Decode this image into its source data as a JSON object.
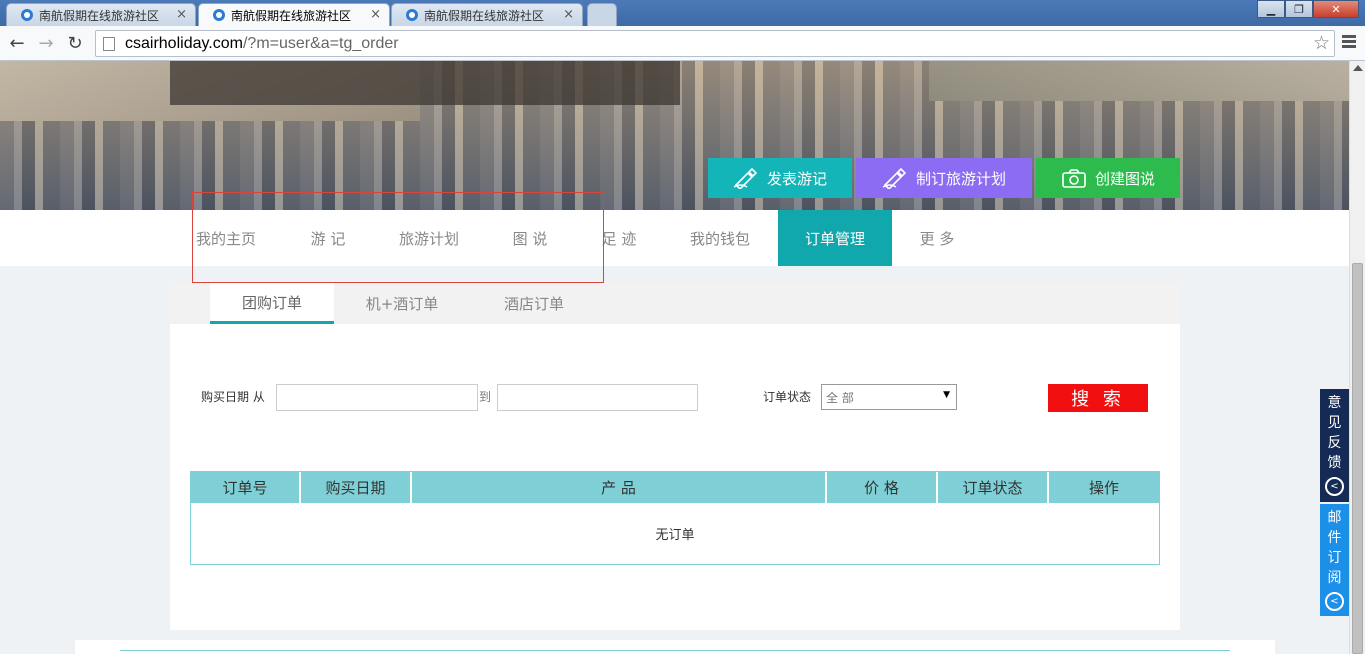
{
  "browser": {
    "tabs": [
      {
        "title": "南航假期在线旅游社区",
        "active": false
      },
      {
        "title": "南航假期在线旅游社区",
        "active": true
      },
      {
        "title": "南航假期在线旅游社区",
        "active": false
      }
    ],
    "tab_close_glyph": "×",
    "url_host": "csairholiday.com",
    "url_path": "/?m=user&a=tg_order",
    "back_glyph": "←",
    "forward_glyph": "→",
    "reload_glyph": "↻",
    "star_glyph": "☆",
    "minimize_glyph": "▁",
    "maximize_glyph": "❐",
    "close_glyph": "✕"
  },
  "banner": {
    "buttons": [
      {
        "label": "发表游记",
        "color": "#13b5b8",
        "icon": "pen-icon"
      },
      {
        "label": "制订旅游计划",
        "color": "#8b6cf2",
        "icon": "pen-icon"
      },
      {
        "label": "创建图说",
        "color": "#2dbb4e",
        "icon": "camera-icon"
      }
    ]
  },
  "nav": {
    "items": [
      "我的主页",
      "游 记",
      "旅游计划",
      "图 说",
      "足 迹",
      "我的钱包",
      "订单管理",
      "更 多"
    ],
    "active_index": 6,
    "active_color": "#10a8ad"
  },
  "subtabs": {
    "items": [
      "团购订单",
      "机+酒订单",
      "酒店订单"
    ],
    "active_index": 0
  },
  "filter": {
    "date_label": "购买日期 从",
    "to_label": "到",
    "status_label": "订单状态",
    "status_selected": "全 部",
    "select_arrow_glyph": "▼",
    "search_label": "搜 索",
    "search_color": "#f20f0f"
  },
  "table": {
    "headers": [
      "订单号",
      "购买日期",
      "产 品",
      "价 格",
      "订单状态",
      "操作"
    ],
    "empty_text": "无订单",
    "header_color": "#7fd0d6"
  },
  "side": {
    "feedback_chars": [
      "意",
      "见",
      "反",
      "馈"
    ],
    "mail_chars": [
      "邮",
      "件",
      "订",
      "阅"
    ],
    "toggle_glyph": "<"
  }
}
